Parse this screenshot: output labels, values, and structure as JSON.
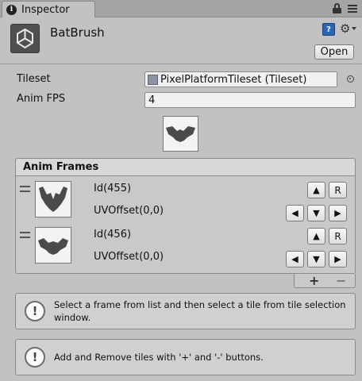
{
  "window": {
    "tab_label": "Inspector",
    "tab_icon": "i"
  },
  "header": {
    "title": "BatBrush",
    "open_label": "Open",
    "book_glyph": "?"
  },
  "properties": {
    "tileset_label": "Tileset",
    "tileset_value": "PixelPlatformTileset (Tileset)",
    "anim_fps_label": "Anim FPS",
    "anim_fps_value": "4"
  },
  "anim_frames": {
    "title": "Anim Frames",
    "frames": [
      {
        "id": "Id(455)",
        "uv": "UVOffset(0,0)"
      },
      {
        "id": "Id(456)",
        "uv": "UVOffset(0,0)"
      }
    ],
    "buttons": {
      "up": "▲",
      "down": "▼",
      "left": "◀",
      "right": "▶",
      "reset": "R"
    },
    "add_label": "+",
    "remove_label": "−"
  },
  "help": [
    {
      "text": "Select a frame from list and then select a tile from tile selection window."
    },
    {
      "text": "Add and Remove tiles with '+' and '-' buttons."
    }
  ],
  "colors": {
    "panel": "#c2c2c2",
    "field": "#f1f1f1",
    "sprite": "#4a4a4a"
  }
}
